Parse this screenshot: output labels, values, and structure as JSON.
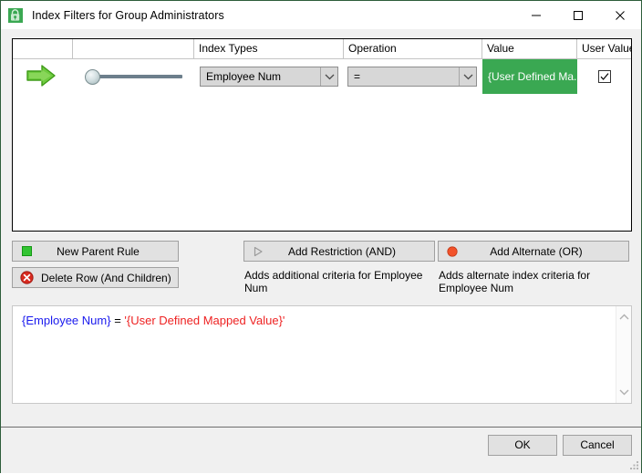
{
  "window": {
    "title": "Index Filters for Group Administrators",
    "icon": "filter-lock-icon",
    "minimize_label": "—",
    "maximize_label": "☐",
    "close_label": "✕"
  },
  "grid": {
    "columns": [
      {
        "key": "arrow",
        "label": ""
      },
      {
        "key": "indent",
        "label": ""
      },
      {
        "key": "index",
        "label": "Index Types"
      },
      {
        "key": "operation",
        "label": "Operation"
      },
      {
        "key": "value",
        "label": "Value"
      },
      {
        "key": "uservalue",
        "label": "User Value"
      }
    ],
    "rows": [
      {
        "marker_icon": "green-right-arrow-icon",
        "indent_level": 0,
        "index_type": "Employee Num",
        "operation": "=",
        "value": "{User Defined Ma...",
        "value_highlight_color": "#3aa852",
        "user_value_checked": true
      }
    ]
  },
  "actions": {
    "new_parent_rule": {
      "label": "New Parent Rule",
      "icon": "green-square-icon"
    },
    "delete_row": {
      "label": "Delete Row (And Children)",
      "icon": "red-x-circle-icon"
    },
    "add_restriction": {
      "label": "Add Restriction (AND)",
      "icon": "gray-triangle-icon",
      "description": "Adds additional criteria for Employee Num"
    },
    "add_alternate": {
      "label": "Add Alternate (OR)",
      "icon": "orange-circle-icon",
      "description": "Adds alternate index criteria for Employee Num"
    }
  },
  "expression": {
    "field": "{Employee Num}",
    "operator": "=",
    "value": "'{User Defined Mapped Value}'",
    "field_color": "#1a1aee",
    "value_color": "#ee2222",
    "scroll_up_icon": "chevron-up-icon",
    "scroll_down_icon": "chevron-down-icon"
  },
  "footer": {
    "ok_label": "OK",
    "cancel_label": "Cancel",
    "resize_grip_icon": "resize-grip-icon"
  }
}
